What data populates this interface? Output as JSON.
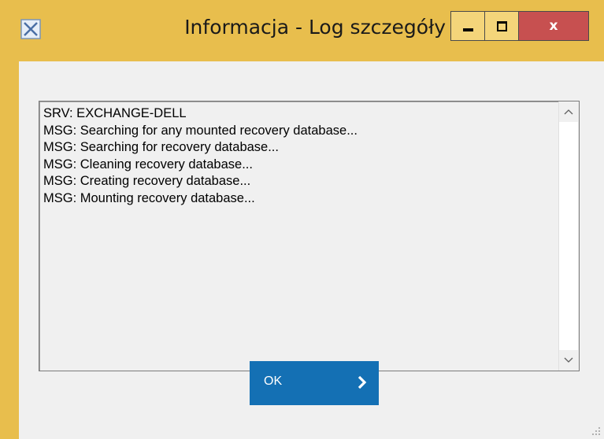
{
  "window": {
    "title": "Informacja - Log szczegóły",
    "app_icon": "app-window-icon",
    "controls": {
      "minimize_icon": "minimize-icon",
      "maximize_icon": "maximize-icon",
      "close_label": "x"
    }
  },
  "log": {
    "lines": [
      "SRV: EXCHANGE-DELL",
      "MSG: Searching for any mounted recovery database...",
      "MSG: Searching for recovery database...",
      "MSG: Cleaning recovery database...",
      "MSG: Creating recovery database...",
      "MSG: Mounting recovery database..."
    ],
    "scroll_up_icon": "chevron-up-icon",
    "scroll_down_icon": "chevron-down-icon"
  },
  "actions": {
    "ok_label": "OK",
    "ok_icon": "chevron-right-icon"
  },
  "colors": {
    "frame": "#e8be4d",
    "client_bg": "#f0f0f0",
    "close_button": "#c75050",
    "ok_button": "#1470b4"
  }
}
